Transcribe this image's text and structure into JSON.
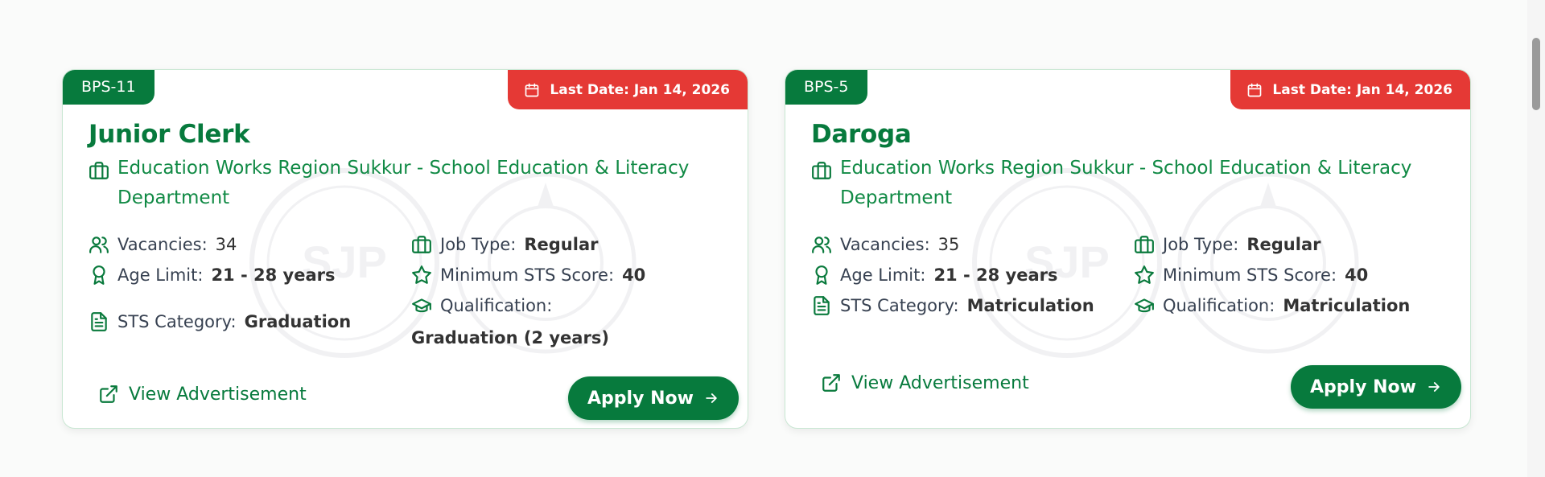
{
  "cards": [
    {
      "bps": "BPS-11",
      "deadline": "Last Date: Jan 14, 2026",
      "title": "Junior Clerk",
      "department": "Education Works Region Sukkur - School Education & Literacy Department",
      "vacancies_label": "Vacancies:",
      "vacancies": "34",
      "age_label": "Age Limit:",
      "age": "21 - 28 years",
      "sts_category_label": "STS Category:",
      "sts_category": "Graduation",
      "job_type_label": "Job Type:",
      "job_type": "Regular",
      "min_sts_label": "Minimum STS Score:",
      "min_sts": "40",
      "qualification_label": "Qualification:",
      "qualification": "Graduation (2 years)",
      "view_ad": "View Advertisement",
      "apply": "Apply Now"
    },
    {
      "bps": "BPS-5",
      "deadline": "Last Date: Jan 14, 2026",
      "title": "Daroga",
      "department": "Education Works Region Sukkur - School Education & Literacy Department",
      "vacancies_label": "Vacancies:",
      "vacancies": "35",
      "age_label": "Age Limit:",
      "age": "21 - 28 years",
      "sts_category_label": "STS Category:",
      "sts_category": "Matriculation",
      "job_type_label": "Job Type:",
      "job_type": "Regular",
      "min_sts_label": "Minimum STS Score:",
      "min_sts": "40",
      "qualification_label": "Qualification:",
      "qualification": "Matriculation",
      "view_ad": "View Advertisement",
      "apply": "Apply Now"
    }
  ],
  "watermark_text": "SJP",
  "colors": {
    "brand_green": "#077a3d",
    "deadline_red": "#e53935",
    "card_border": "#c9e7d3"
  },
  "icons": {
    "deadline": "calendar-icon",
    "department": "briefcase-icon",
    "vacancies": "users-icon",
    "age": "award-icon",
    "sts_category": "document-icon",
    "job_type": "briefcase-icon",
    "min_sts": "star-icon",
    "qualification": "graduation-cap-icon",
    "view_ad": "external-link-icon",
    "apply": "arrow-right-icon"
  }
}
